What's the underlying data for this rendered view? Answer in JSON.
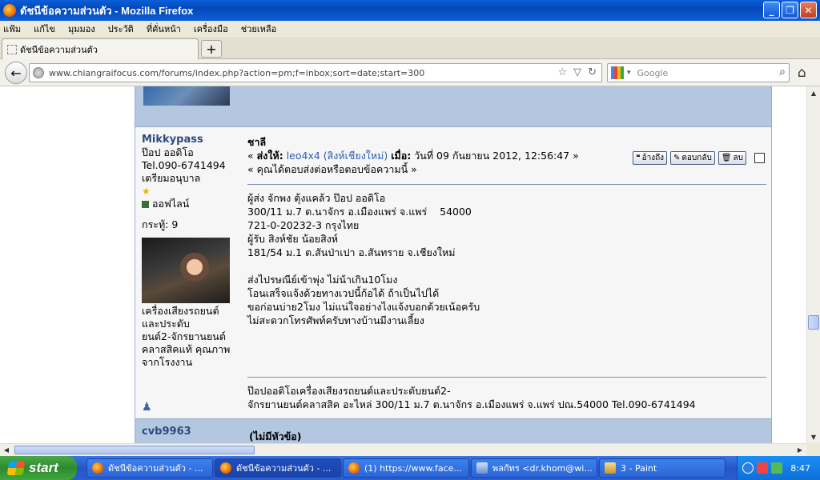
{
  "window": {
    "title": "ดัชนีข้อความส่วนตัว - Mozilla Firefox"
  },
  "menu": [
    "แฟ้ม",
    "แก้ไข",
    "มุมมอง",
    "ประวัติ",
    "ที่คั่นหน้า",
    "เครื่องมือ",
    "ช่วยเหลือ"
  ],
  "tab": {
    "label": "ดัชนีข้อความส่วนตัว",
    "new_tab": "+"
  },
  "nav": {
    "url": "www.chiangraifocus.com/forums/index.php?action=pm;f=inbox;sort=date;start=300",
    "search_placeholder": "Google"
  },
  "post": {
    "poster": {
      "name": "Mikkypass",
      "line1": "ป๊อป ออดิโอ",
      "line2": "Tel.090-6741494",
      "line3": "เตรียมอนุบาล",
      "status": "ออฟไลน์",
      "posts": "กระทู้: 9",
      "text1": "เครื่องเสียงรถยนต์",
      "text2": "และประดับ",
      "text3": "ยนต์2-จักรยานยนต์",
      "text4": "คลาสสิคแท้ คุณภาพ",
      "text5": "จากโรงงาน"
    },
    "subject": "ชาลี",
    "meta": {
      "prefix": "« ",
      "to_label": "ส่งให้:",
      "recipient": "leo4x4 (สิงห์เชียงใหม่)",
      "when_label": "เมื่อ:",
      "date": "วันที่ 09 กันยายน 2012, 12:56:47 »",
      "replied": "« คุณได้ตอบส่งต่อหรือตอบข้อความนี้ »"
    },
    "actions": {
      "quote": "อ้างถึง",
      "reply": "ตอบกลับ",
      "delete": "ลบ"
    },
    "body": [
      "ผู้ส่ง จักพง ตุ้งแคล้ว ป๊อป ออดิโอ",
      "300/11 ม.7 ต.นาจักร อ.เมืองแพร่ จ.แพร่    54000",
      "721-0-20232-3 กรุงไทย",
      "ผู้รับ สิงห์ชัย น้อยสิงห์",
      "181/54 ม.1 ต.สันป่าเปา อ.สันทราย จ.เชียงใหม่",
      "",
      "ส่งไปรษณีย์เข้าพุ่ง ไม่น้าเกิน10โมง",
      "โอนเสร็จแจ้งด้วยทางเวปนี้ก้อได้ ถ้าเป็นไปได้",
      "ขอก่อนบ่าย2โมง ไม่แน่ใจอย่างไงแจ้งบอกด้วยเน้อครับ",
      "ไม่สะดวกโทรศัพท์ครับทางบ้านมีงานเลี้ยง"
    ],
    "signature1": "ป๊อปออดิโอเครื่องเสียงรถยนต์และประดับยนต์2-",
    "signature2": "จักรยานยนต์คลาสสิค อะไหล่ 300/11 ม.7 ต.นาจักร อ.เมืองแพร่ จ.แพร่ ปณ.54000 Tel.090-6741494"
  },
  "next_post": {
    "name": "cvb9963",
    "subject": "(ไม่มีหัวข้อ)"
  },
  "taskbar": {
    "start": "start",
    "tasks": [
      "ดัชนีข้อความส่วนตัว - ...",
      "ดัชนีข้อความส่วนตัว - ...",
      "(1) https://www.face...",
      "พลกัทร <dr.khom@wi...",
      "3 - Paint"
    ],
    "clock": "8:47"
  },
  "colors": {
    "titlebar": "#0a5fd8",
    "post_header": "#b3c8e0",
    "link": "#2d5cb2",
    "username": "#2d4b80"
  }
}
